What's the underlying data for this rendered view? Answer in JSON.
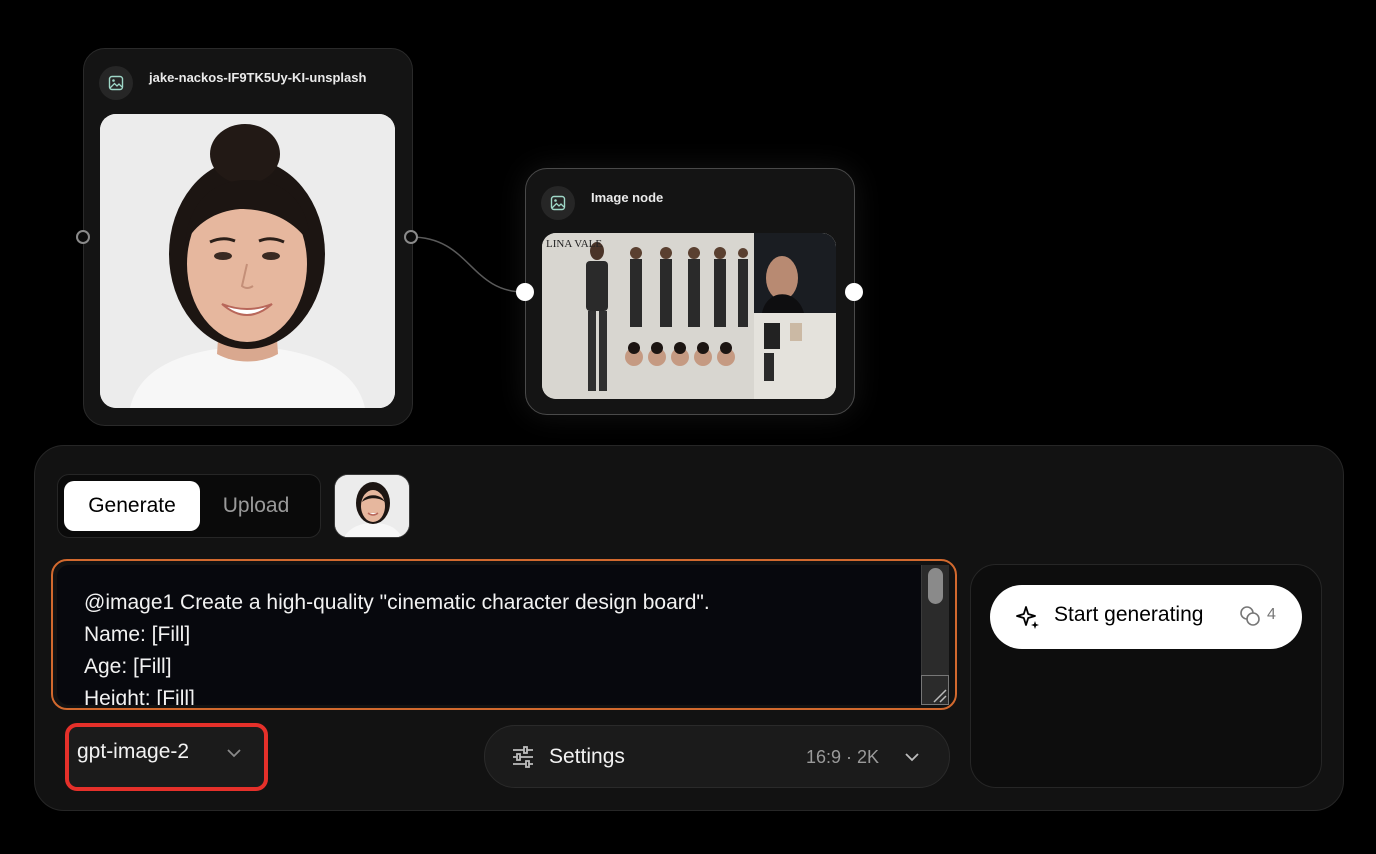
{
  "nodes": {
    "source": {
      "title": "jake-nackos-IF9TK5Uy-KI-unsplash"
    },
    "output": {
      "title": "Image node",
      "board_heading": "LINA VALE"
    }
  },
  "panel": {
    "tabs": [
      {
        "label": "Generate",
        "active": true
      },
      {
        "label": "Upload",
        "active": false
      }
    ],
    "prompt_text": "@image1 Create a high-quality \"cinematic character design board\".\nName: [Fill]\nAge: [Fill]\nHeight: [Fill]",
    "model": {
      "label": "gpt-image-2"
    },
    "settings": {
      "label": "Settings",
      "value": "16:9 · 2K"
    },
    "start": {
      "label": "Start generating",
      "credits": "4"
    }
  },
  "colors": {
    "background": "#000000",
    "panel": "#121212",
    "prompt_focus_border": "#d2692e",
    "model_highlight": "#e5302a"
  },
  "icons": [
    "image-icon",
    "chevron-down-icon",
    "sliders-icon",
    "sparkle-icon",
    "coins-icon"
  ]
}
